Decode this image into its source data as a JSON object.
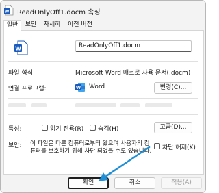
{
  "window": {
    "title": "ReadOnlyOff1.docm 속성"
  },
  "tabs": [
    "일반",
    "보안",
    "자세히",
    "이전 버전"
  ],
  "general": {
    "file_name": "ReadOnlyOff1.docm",
    "file_type_label": "파일 형식:",
    "file_type_value": "Microsoft Word 매크로 사용 문서(.docm)",
    "opens_with_label": "연결 프로그램:",
    "opens_with_app": "Word",
    "change_button": "변경(C)...",
    "attributes_label": "특성:",
    "readonly_label": "읽기 전용(R)",
    "hidden_label": "숨김(H)",
    "advanced_button": "고급(D)...",
    "security_label": "보안:",
    "security_text": "이 파일은 다른 컴퓨터로부터 왔으며 사용자의 컴퓨터를 보호하기 위해 차단 되었을 수도 있습니다.",
    "unblock_label": "차단 해제(K)"
  },
  "footer": {
    "ok": "확인",
    "cancel": "취소",
    "apply": "적용(A)"
  },
  "colors": {
    "word_blue": "#185abd",
    "arrow_blue": "#1e8fd6",
    "accent": "#0067c0"
  },
  "icons": {
    "title": "word-doc-icon",
    "file": "word-doc-icon",
    "app": "word-app-icon",
    "annotation": "arrow-annotation"
  }
}
